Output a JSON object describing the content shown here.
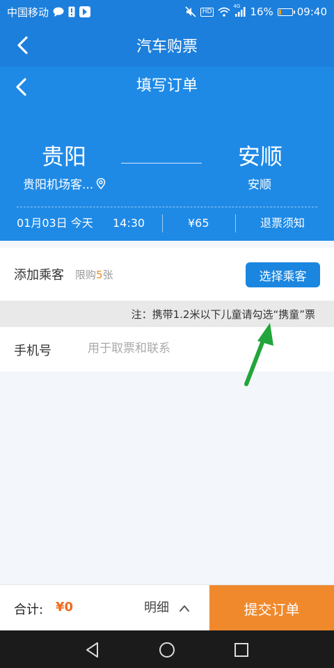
{
  "status_bar": {
    "carrier": "中国移动",
    "network_badge": "HD",
    "signal_badge": "4G",
    "battery_text": "16%",
    "battery_level": 0.16,
    "time": "09:40",
    "icons": [
      "message-icon",
      "alert-icon",
      "app-notification-icon",
      "mute-icon",
      "wifi-icon",
      "signal-icon",
      "battery-icon"
    ]
  },
  "app_bar": {
    "title": "汽车购票",
    "back_icon": "back-chevron-icon"
  },
  "order": {
    "title": "填写订单",
    "from_city": "贵阳",
    "to_city": "安顺",
    "from_station": "贵阳机场客...",
    "to_station": "安顺",
    "date": "01月03日 今天",
    "time": "14:30",
    "price": "¥65",
    "refund_notice": "退票须知"
  },
  "passenger": {
    "label": "添加乘客",
    "limit_prefix": "限购",
    "limit_count": "5",
    "limit_suffix": "张",
    "choose_button": "选择乘客"
  },
  "note": "注：携带1.2米以下儿童请勾选“携童”票",
  "phone": {
    "label": "手机号",
    "placeholder": "用于取票和联系",
    "value": ""
  },
  "bottom": {
    "total_label": "合计:",
    "total_value": "¥0",
    "detail_label": "明细",
    "submit_button": "提交订单"
  },
  "colors": {
    "primary_blue": "#1c7fdc",
    "button_blue": "#1a86e0",
    "submit_orange": "#f0892c",
    "price_orange": "#f06a1e",
    "annotation_arrow": "#22a53a"
  }
}
